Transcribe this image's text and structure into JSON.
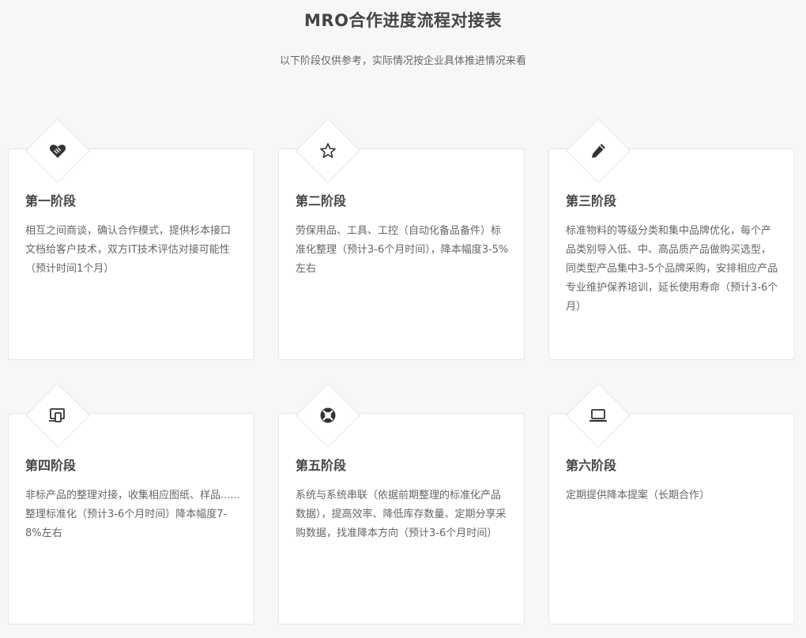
{
  "header": {
    "title": "MRO合作进度流程对接表",
    "subtitle": "以下阶段仅供参考，实际情况按企业具体推进情况来看"
  },
  "stages": [
    {
      "icon": "handshake-heart-icon",
      "title": "第一阶段",
      "description": "相互之间商谈，确认合作模式，提供杉本接口文档给客户技术，双方IT技术评估对接可能性（预计时间1个月）"
    },
    {
      "icon": "star-icon",
      "title": "第二阶段",
      "description": "劳保用品、工具、工控（自动化备品备件）标准化整理（预计3-6个月时间），降本幅度3-5%左右"
    },
    {
      "icon": "pen-icon",
      "title": "第三阶段",
      "description": "标准物料的等级分类和集中品牌优化，每个产品类别导入低、中、高品质产品做购买选型，同类型产品集中3-5个品牌采购，安排相应产品专业维护保养培训，延长使用寿命（预计3-6个月）"
    },
    {
      "icon": "devices-icon",
      "title": "第四阶段",
      "description": "非标产品的整理对接，收集相应图纸、样品......整理标准化（预计3-6个月时间）降本幅度7-8%左右"
    },
    {
      "icon": "lifebuoy-icon",
      "title": "第五阶段",
      "description": "系统与系统串联（依据前期整理的标准化产品数据），提高效率、降低库存数量、定期分享采购数据，找准降本方向（预计3-6个月时间）"
    },
    {
      "icon": "laptop-icon",
      "title": "第六阶段",
      "description": "定期提供降本提案（长期合作）"
    }
  ],
  "colors": {
    "background": "#f6f7f9",
    "card": "#ffffff",
    "border": "#e6e6e6",
    "title": "#444444",
    "text": "#666666",
    "icon": "#333333"
  }
}
